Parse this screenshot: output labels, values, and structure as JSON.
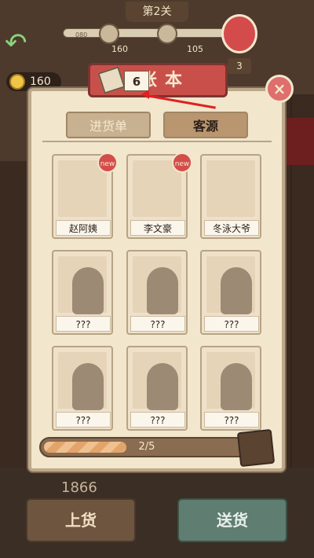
{
  "level": {
    "title": "第2关"
  },
  "progress_bar": {
    "start_label": "080",
    "marker_1_value": "160",
    "marker_2_value": "105",
    "reward_count": "3"
  },
  "currency": {
    "coins": "160"
  },
  "modal": {
    "title": "账本",
    "ticket_count": "6",
    "tabs": [
      {
        "label": "进货单",
        "selected": false
      },
      {
        "label": "客源",
        "selected": true
      }
    ],
    "cards": [
      {
        "name": "赵阿姨",
        "new": true
      },
      {
        "name": "李文豪",
        "new": true
      },
      {
        "name": "冬泳大爷",
        "new": false
      },
      {
        "name": "???",
        "new": false
      },
      {
        "name": "???",
        "new": false
      },
      {
        "name": "???",
        "new": false
      },
      {
        "name": "???",
        "new": false
      },
      {
        "name": "???",
        "new": false
      },
      {
        "name": "???",
        "new": false
      }
    ],
    "new_badge_text": "new",
    "collection_progress": {
      "text": "2/5",
      "fraction": 0.4
    }
  },
  "bottom": {
    "number": "1866",
    "load_button": "上货",
    "send_button": "送货"
  },
  "colors": {
    "accent_red": "#c9504a",
    "panel": "#f2e6cd",
    "close_red": "#df6e6e",
    "arrow_red": "#e02020",
    "send_green": "#5f7d70"
  }
}
